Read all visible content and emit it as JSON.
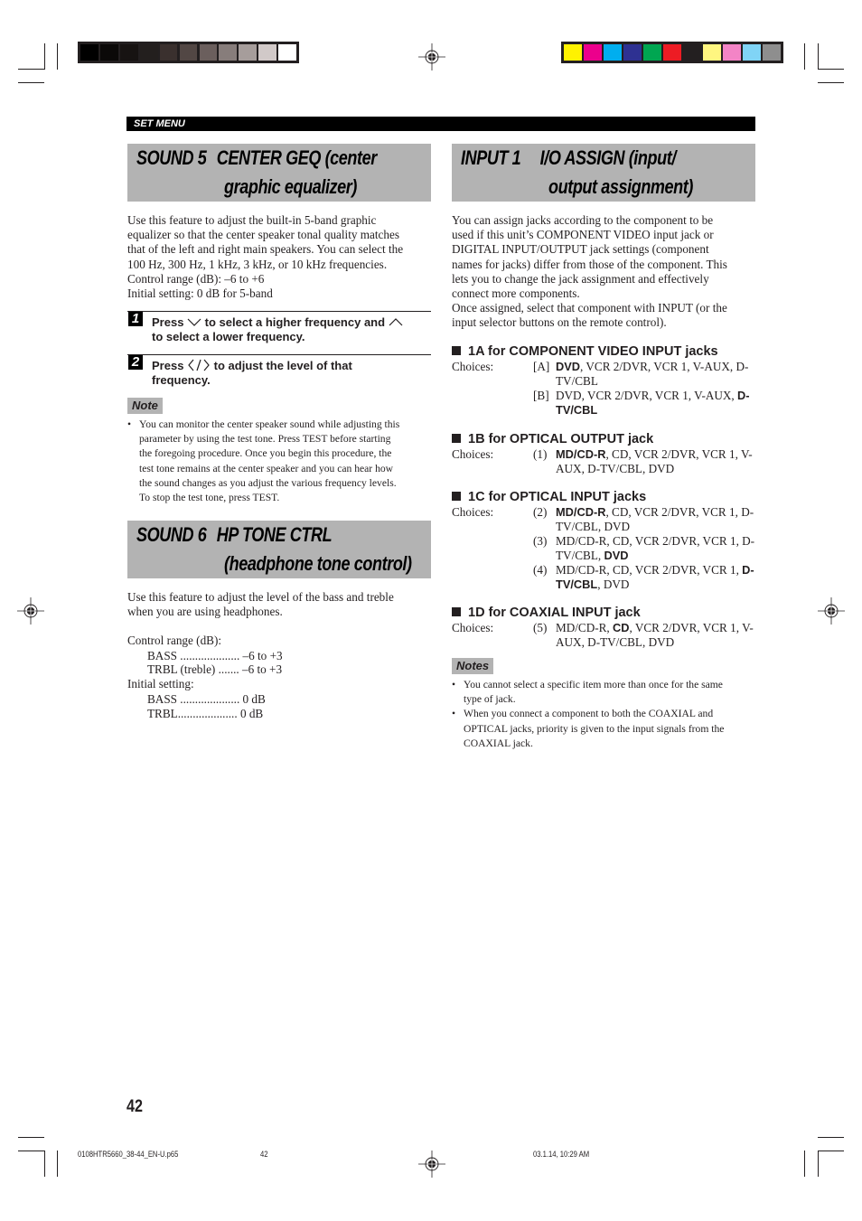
{
  "print_marks": {
    "gray_swatches": [
      "#000000",
      "#0b0908",
      "#171312",
      "#231f1e",
      "#3a302e",
      "#524744",
      "#6b5f5d",
      "#877d7b",
      "#a69d9b",
      "#d1c9c8",
      "#ffffff"
    ],
    "color_swatches": [
      "#fff200",
      "#ec008c",
      "#00aeef",
      "#2e3192",
      "#00a651",
      "#ed1c24",
      "#231f20",
      "#fff680",
      "#f384c6",
      "#80d4f6",
      "#8e8e8e"
    ]
  },
  "section_label": "SET MENU",
  "left": {
    "sound5": {
      "heading_line1_code": "SOUND 5",
      "heading_line1_title": "CENTER GEQ (center",
      "heading_line2": "graphic equalizer)",
      "body": [
        "Use this feature to adjust the built-in 5-band graphic",
        "equalizer so that the center speaker tonal quality matches",
        "that of the left and right main speakers. You can select the",
        "100 Hz, 300 Hz, 1 kHz, 3 kHz, or 10 kHz frequencies.",
        "Control range (dB): –6 to +6",
        "Initial setting: 0 dB for 5-band"
      ],
      "steps": [
        {
          "num": "1",
          "line1_a": "Press",
          "line1_b": "to select a higher frequency and",
          "line2": "to select a lower frequency."
        },
        {
          "num": "2",
          "line1_a": "Press",
          "line1_b": "to adjust the level of that",
          "line2": "frequency."
        }
      ],
      "note_label": "Note",
      "note_bullet": "•",
      "note_lines": [
        "You can monitor the center speaker sound while adjusting this",
        "parameter by using the test tone. Press TEST before starting",
        "the foregoing procedure. Once you begin this procedure, the",
        "test tone remains at the center speaker and you can hear how",
        "the sound changes as you adjust the various frequency levels.",
        "To stop the test tone, press TEST."
      ]
    },
    "sound6": {
      "heading_line1_code": "SOUND 6",
      "heading_line1_title": "HP TONE CTRL",
      "heading_line2": "(headphone tone control)",
      "body": [
        "Use this feature to adjust the level of the bass and treble",
        "when you are using headphones."
      ],
      "control_range_label": "Control range (dB):",
      "control_range": [
        {
          "name": "BASS",
          "dots": "....................",
          "value": "–6 to +3"
        },
        {
          "name": "TRBL (treble)",
          "dots": ".......",
          "value": "–6 to +3"
        }
      ],
      "initial_label": "Initial setting:",
      "initial": [
        {
          "name": "BASS",
          "dots": "....................",
          "value": "0 dB"
        },
        {
          "name": "TRBL",
          "dots": "....................",
          "value": "0 dB"
        }
      ]
    }
  },
  "right": {
    "input1": {
      "heading_line1_code": "INPUT 1",
      "heading_line1_title": "I/O ASSIGN (input/",
      "heading_line2": "output assignment)",
      "body": [
        "You can assign jacks according to the component to be",
        "used if this unit’s COMPONENT VIDEO input jack or",
        "DIGITAL INPUT/OUTPUT jack settings (component",
        "names for jacks) differ from those of the component. This",
        "lets you to change the jack assignment and effectively",
        "connect more components.",
        "Once assigned, select that component with INPUT (or the",
        "input selector buttons on the remote control)."
      ],
      "choices_label": "Choices:",
      "groups": [
        {
          "title": "1A for COMPONENT VIDEO INPUT jacks",
          "options": [
            {
              "idx": "[A]",
              "bold_pre": "DVD",
              "rest": ", VCR 2/DVR, VCR 1, V-AUX, D-TV/CBL"
            },
            {
              "idx": "[B]",
              "pre": "DVD, VCR 2/DVR, VCR 1, V-AUX, ",
              "bold_post": "D-TV/CBL"
            }
          ]
        },
        {
          "title": "1B for OPTICAL OUTPUT jack",
          "options": [
            {
              "idx": "(1)",
              "bold_pre": "MD/CD-R",
              "rest": ", CD, VCR 2/DVR, VCR 1, V-AUX, D-TV/CBL, DVD"
            }
          ]
        },
        {
          "title": "1C for OPTICAL INPUT jacks",
          "options": [
            {
              "idx": "(2)",
              "bold_pre": "MD/CD-R",
              "rest": ", CD, VCR 2/DVR, VCR 1, D-TV/CBL, DVD"
            },
            {
              "idx": "(3)",
              "pre": "MD/CD-R, CD, VCR 2/DVR, VCR 1, D-TV/CBL, ",
              "bold_post": "DVD"
            },
            {
              "idx": "(4)",
              "pre": "MD/CD-R, CD, VCR 2/DVR, VCR 1, ",
              "bold_mid": "D-TV/CBL",
              "rest": ", DVD"
            }
          ]
        },
        {
          "title": "1D for COAXIAL INPUT jack",
          "options": [
            {
              "idx": "(5)",
              "pre": "MD/CD-R, ",
              "bold_mid": "CD",
              "rest": ", VCR 2/DVR, VCR 1, V-AUX, D-TV/CBL, DVD"
            }
          ]
        }
      ],
      "notes_label": "Notes",
      "notes": [
        {
          "bullet": "•",
          "lines": [
            "You cannot select a specific item more than once for the same",
            "type of jack."
          ]
        },
        {
          "bullet": "•",
          "lines": [
            "When you connect a component to both the COAXIAL and",
            "OPTICAL jacks, priority is given to the input signals from the",
            "COAXIAL jack."
          ]
        }
      ]
    }
  },
  "page_number": "42",
  "footer": {
    "file": "0108HTR5660_38-44_EN-U.p65",
    "page": "42",
    "timestamp": "03.1.14, 10:29 AM"
  }
}
